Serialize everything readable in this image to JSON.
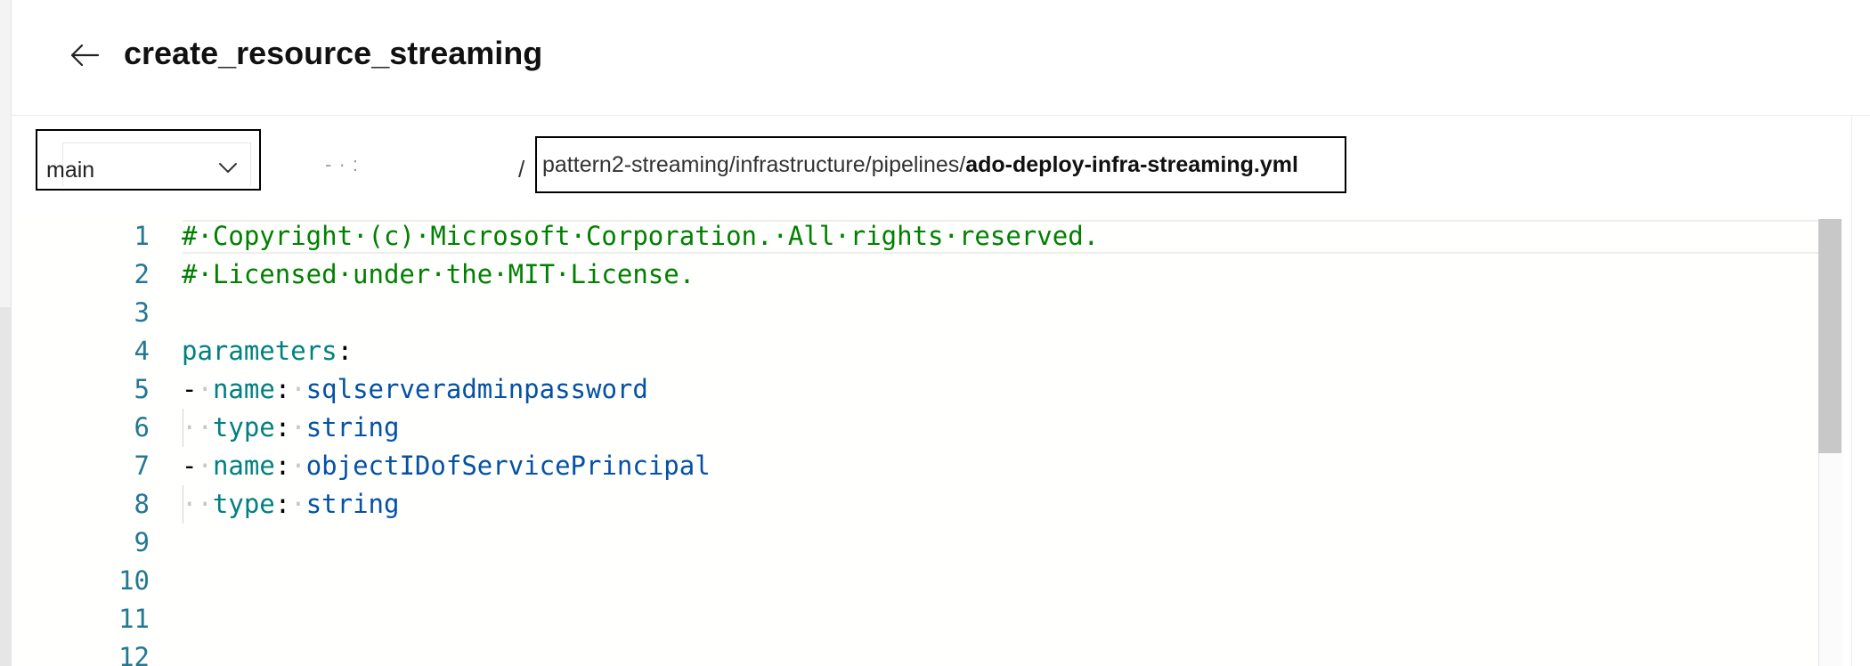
{
  "header": {
    "back_icon": "arrow-left-icon",
    "title": "create_resource_streaming"
  },
  "branch": {
    "name": "main",
    "chevron_icon": "chevron-down-icon"
  },
  "breadcrumb": {
    "repo_fragment": "- · :",
    "separator": "/",
    "path_prefix": "pattern2-streaming/infrastructure/pipelines/",
    "file_name": "ado-deploy-infra-streaming.yml"
  },
  "editor": {
    "line_numbers": [
      "1",
      "2",
      "3",
      "4",
      "5",
      "6",
      "7",
      "8",
      "9",
      "10",
      "11",
      "12"
    ],
    "lines": [
      {
        "comment": "#·Copyright·(c)·Microsoft·Corporation.·All·rights·reserved."
      },
      {
        "comment": "#·Licensed·under·the·MIT·License."
      },
      {},
      {
        "key": "parameters",
        "punct": ":"
      },
      {
        "dash": "-",
        "ws1": "·",
        "key": "name",
        "punct": ":",
        "ws2": "·",
        "val": "sqlserveradminpassword"
      },
      {
        "ws_indent": "··",
        "key": "type",
        "punct": ":",
        "ws2": "·",
        "val": "string"
      },
      {
        "dash": "-",
        "ws1": "·",
        "key": "name",
        "punct": ":",
        "ws2": "·",
        "val": "objectIDofServicePrincipal"
      },
      {
        "ws_indent": "··",
        "key": "type",
        "punct": ":",
        "ws2": "·",
        "val": "string"
      },
      {},
      {},
      {},
      {}
    ]
  },
  "colors": {
    "comment": "#008000",
    "key": "#008080",
    "value": "#0451a5",
    "line_number": "#237893"
  }
}
